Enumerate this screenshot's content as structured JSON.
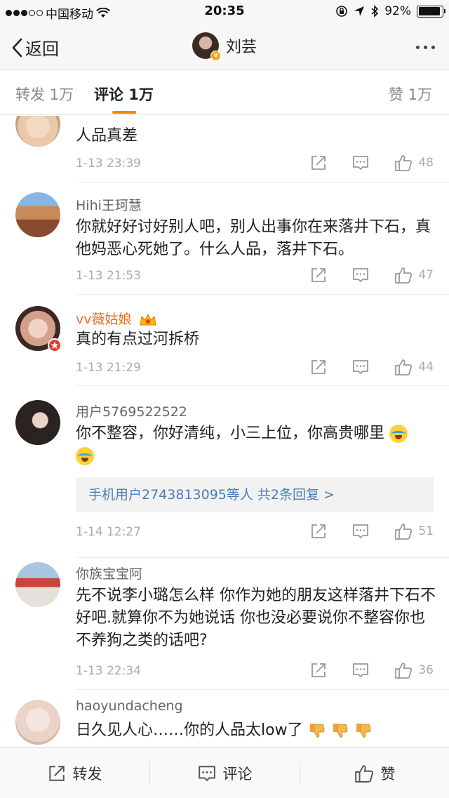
{
  "status_bar": {
    "carrier": "中国移动",
    "time": "20:35",
    "battery": "92%",
    "battery_level": 0.92
  },
  "nav": {
    "back_label": "返回",
    "title": "刘芸"
  },
  "tabs": {
    "repost": "转发 1万",
    "comment": "评论 1万",
    "like": "赞 1万"
  },
  "comments": [
    {
      "username": "",
      "text": "人品真差",
      "time": "1-13 23:39",
      "likes": "48"
    },
    {
      "username": "Hihi王珂慧",
      "text": "你就好好讨好别人吧，别人出事你在来落井下石，真他妈恶心死她了。什么人品，落井下石。",
      "time": "1-13 21:53",
      "likes": "47"
    },
    {
      "username": "vv薇姑娘",
      "text": "真的有点过河拆桥",
      "time": "1-13 21:29",
      "likes": "44"
    },
    {
      "username": "用户5769522522",
      "text": "你不整容，你好清纯，小三上位，你高贵哪里",
      "reply_summary": "手机用户2743813095等人  共2条回复 >",
      "time": "1-14 12:27",
      "likes": "51"
    },
    {
      "username": "你族宝宝阿",
      "text": "先不说李小璐怎么样 你作为她的朋友这样落井下石不好吧.就算你不为她说话 你也没必要说你不整容你也不养狗之类的话吧?",
      "time": "1-13 22:34",
      "likes": "36"
    },
    {
      "username": "haoyundacheng",
      "text": "日久见人心……你的人品太low了",
      "time": "",
      "likes": ""
    }
  ],
  "bottom_bar": {
    "repost": "转发",
    "comment": "评论",
    "like": "赞"
  }
}
